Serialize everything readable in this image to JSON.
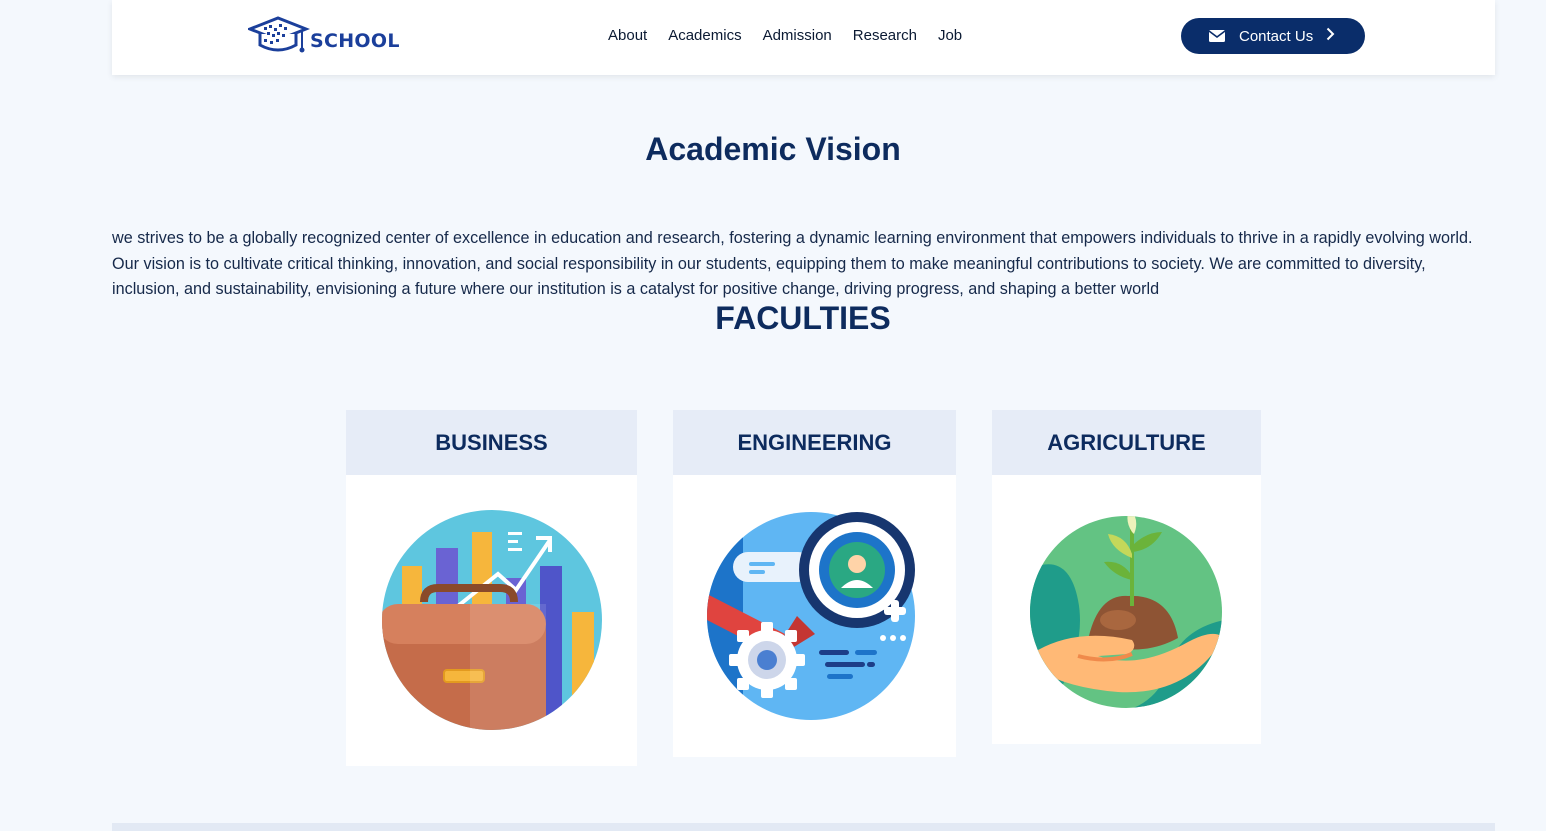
{
  "header": {
    "logo_text": "SCHOOL",
    "nav": [
      "About",
      "Academics",
      "Admission",
      "Research",
      "Job"
    ],
    "contact_label": "Contact Us"
  },
  "vision": {
    "title": "Academic Vision",
    "text": "we strives to be a globally recognized center of excellence in education and research, fostering a dynamic learning environment that empowers individuals to thrive in a rapidly evolving world. Our vision is to cultivate critical thinking, innovation, and social responsibility in our students, equipping them to make meaningful contributions to society. We are committed to diversity, inclusion, and sustainability, envisioning a future where our institution is a catalyst for positive change, driving progress, and shaping a better world"
  },
  "faculties": {
    "title": "FACULTIES",
    "cards": [
      {
        "label": "BUSINESS",
        "icon": "briefcase-chart-icon"
      },
      {
        "label": "ENGINEERING",
        "icon": "gear-magnifier-icon"
      },
      {
        "label": "AGRICULTURE",
        "icon": "plant-in-hands-icon"
      }
    ]
  },
  "colors": {
    "primary": "#0a2d6a",
    "background": "#f4f8fd",
    "card_header": "#e6ecf7"
  }
}
